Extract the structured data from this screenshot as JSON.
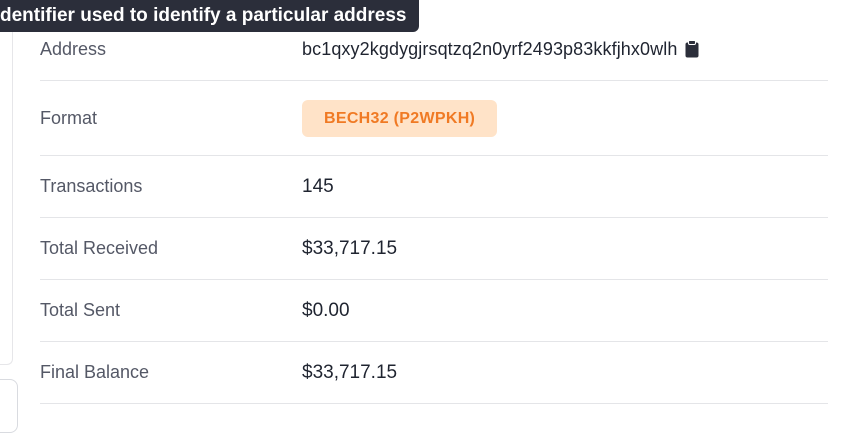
{
  "tooltip": {
    "text": "dentifier used to identify a particular address"
  },
  "details": {
    "address": {
      "label": "Address",
      "value": "bc1qxy2kgdygjrsqtzq2n0yrf2493p83kkfjhx0wlh",
      "icon": "clipboard-icon"
    },
    "format": {
      "label": "Format",
      "value": "BECH32 (P2WPKH)",
      "badge_bg": "#ffe3c8",
      "badge_fg": "#f07a24"
    },
    "transactions": {
      "label": "Transactions",
      "value": "145"
    },
    "total_received": {
      "label": "Total Received",
      "value": "$33,717.15"
    },
    "total_sent": {
      "label": "Total Sent",
      "value": "$0.00"
    },
    "final_balance": {
      "label": "Final Balance",
      "value": "$33,717.15"
    }
  }
}
